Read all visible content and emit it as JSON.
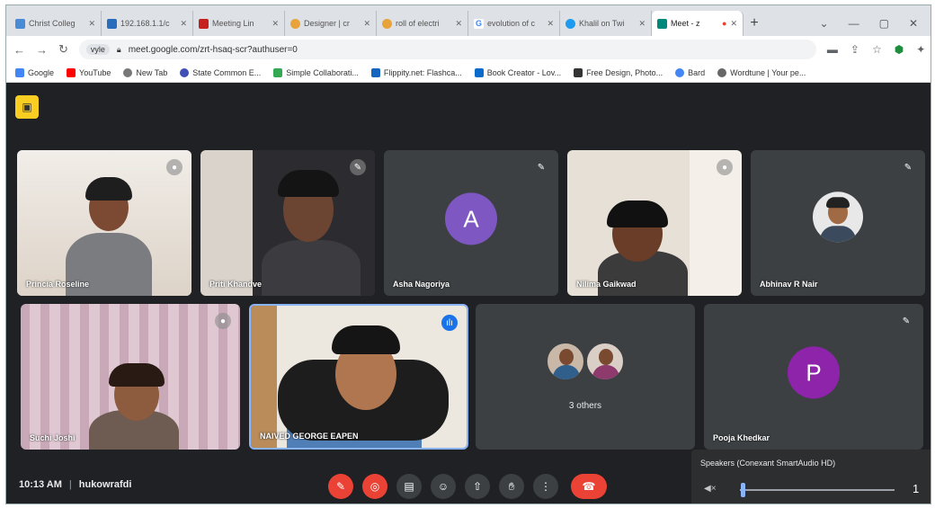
{
  "browser": {
    "tabs": [
      {
        "label": "Christ Colleg",
        "color": "#4a8bd6"
      },
      {
        "label": "192.168.1.1/c",
        "color": "#2a6ebb"
      },
      {
        "label": "Meeting Lin",
        "color": "#c5221f"
      },
      {
        "label": "Designer | cr",
        "color": "#e8a43a"
      },
      {
        "label": "roll of electri",
        "color": "#e8a43a"
      },
      {
        "label": "evolution of c",
        "color": "#4285f4"
      },
      {
        "label": "Khalil on Twi",
        "color": "#1d9bf0"
      },
      {
        "label": "Meet - z",
        "color": "#00897b"
      }
    ],
    "new_tab": "+",
    "url": "meet.google.com/zrt-hsaq-scr?authuser=0",
    "url_prefix": "vyle",
    "bookmarks": [
      {
        "label": "Google",
        "color": "#4285f4"
      },
      {
        "label": "YouTube",
        "color": "#ff0000"
      },
      {
        "label": "New Tab",
        "color": "#777777"
      },
      {
        "label": "State Common E...",
        "color": "#3f51b5"
      },
      {
        "label": "Simple Collaborati...",
        "color": "#34a853"
      },
      {
        "label": "Flippity.net: Flashca...",
        "color": "#1565c0"
      },
      {
        "label": "Book Creator - Lov...",
        "color": "#0b6bcb"
      },
      {
        "label": "Free Design, Photo...",
        "color": "#333333"
      },
      {
        "label": "Bard",
        "color": "#4285f4"
      },
      {
        "label": "Wordtune | Your pe...",
        "color": "#666666"
      }
    ]
  },
  "participants": [
    {
      "name": "Princia Roseline"
    },
    {
      "name": "Priti Khandve"
    },
    {
      "name": "Asha Nagoriya",
      "initial": "A",
      "color": "#7e57c2"
    },
    {
      "name": "Nilima Gaikwad"
    },
    {
      "name": "Abhinav R Nair"
    },
    {
      "name": "Suchi Joshi"
    },
    {
      "name": "NAIVED GEORGE EAPEN"
    },
    {
      "name": "3 others"
    },
    {
      "name": "Pooja Khedkar",
      "initial": "P",
      "color": "#8e24aa"
    }
  ],
  "meeting": {
    "time": "10:13 AM",
    "separator": "|",
    "code": "hukowrafdi"
  },
  "speaker": {
    "title": "Speakers (Conexant SmartAudio HD)",
    "volume_value": "1",
    "volume_level": 0.02
  }
}
